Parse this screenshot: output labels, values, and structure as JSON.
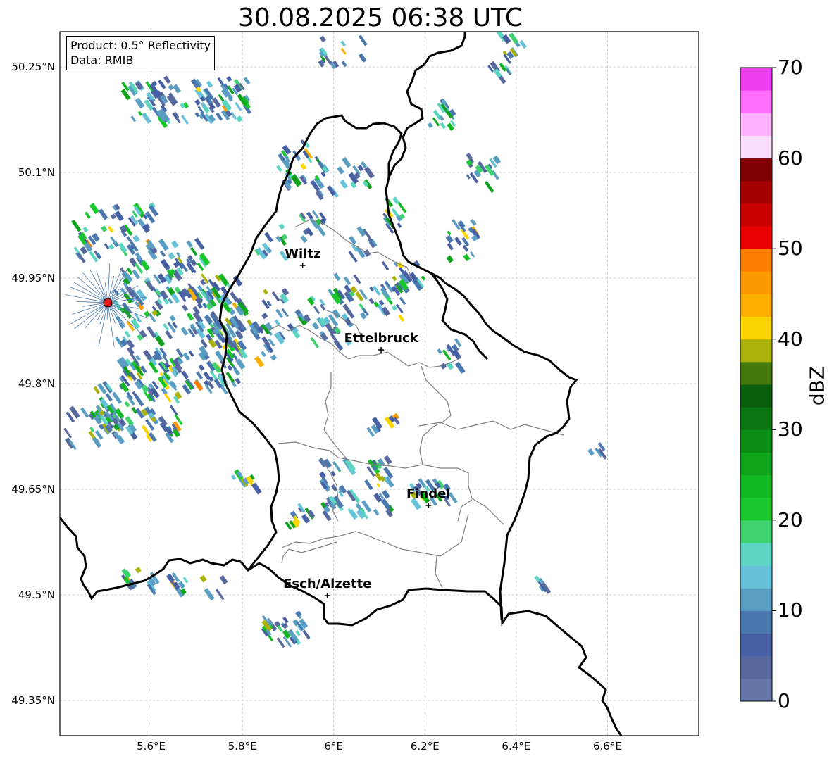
{
  "title": "30.08.2025 06:38 UTC",
  "info_box": {
    "product": "Product: 0.5° Reflectivity",
    "data_source": "Data: RMIB"
  },
  "map": {
    "lon_range": [
      5.4,
      6.8
    ],
    "lat_range": [
      49.3,
      50.3
    ],
    "lat_ticks": [
      {
        "value": 50.25,
        "label": "50.25°N"
      },
      {
        "value": 50.1,
        "label": "50.1°N"
      },
      {
        "value": 49.95,
        "label": "49.95°N"
      },
      {
        "value": 49.8,
        "label": "49.8°N"
      },
      {
        "value": 49.65,
        "label": "49.65°N"
      },
      {
        "value": 49.5,
        "label": "49.5°N"
      },
      {
        "value": 49.35,
        "label": "49.35°N"
      }
    ],
    "lon_ticks": [
      {
        "value": 5.6,
        "label": "5.6°E"
      },
      {
        "value": 5.8,
        "label": "5.8°E"
      },
      {
        "value": 6.0,
        "label": "6°E"
      },
      {
        "value": 6.2,
        "label": "6.2°E"
      },
      {
        "value": 6.4,
        "label": "6.4°E"
      },
      {
        "value": 6.6,
        "label": "6.6°E"
      }
    ],
    "grid": true,
    "radar_site": {
      "lon": 5.505,
      "lat": 49.915,
      "color": "#e31a1c"
    },
    "cities": [
      {
        "name": "Wiltz",
        "lon": 5.932,
        "lat": 49.968
      },
      {
        "name": "Ettelbruck",
        "lon": 6.104,
        "lat": 49.848
      },
      {
        "name": "Findel",
        "lon": 6.208,
        "lat": 49.627
      },
      {
        "name": "Esch/Alzette",
        "lon": 5.986,
        "lat": 49.499
      }
    ]
  },
  "colorbar": {
    "label": "dBZ",
    "min": 0,
    "max": 70,
    "ticks": [
      {
        "value": 0,
        "label": "0"
      },
      {
        "value": 10,
        "label": "10"
      },
      {
        "value": 20,
        "label": "20"
      },
      {
        "value": 30,
        "label": "30"
      },
      {
        "value": 40,
        "label": "40"
      },
      {
        "value": 50,
        "label": "50"
      },
      {
        "value": 60,
        "label": "60"
      },
      {
        "value": 70,
        "label": "70"
      }
    ],
    "colors": [
      "#6577a8",
      "#56689e",
      "#4660a3",
      "#4a78ae",
      "#5a9ec4",
      "#66c2d9",
      "#5cd6c2",
      "#3ed36f",
      "#18c82c",
      "#12b821",
      "#0fa31b",
      "#0b8c15",
      "#0a7612",
      "#0a600e",
      "#45790e",
      "#aab20b",
      "#fbd500",
      "#fbb000",
      "#fc9a00",
      "#fc7e00",
      "#e60000",
      "#c90000",
      "#a40000",
      "#7e0000",
      "#ffdfff",
      "#ffb2ff",
      "#ff6eff",
      "#ed3ded"
    ]
  }
}
